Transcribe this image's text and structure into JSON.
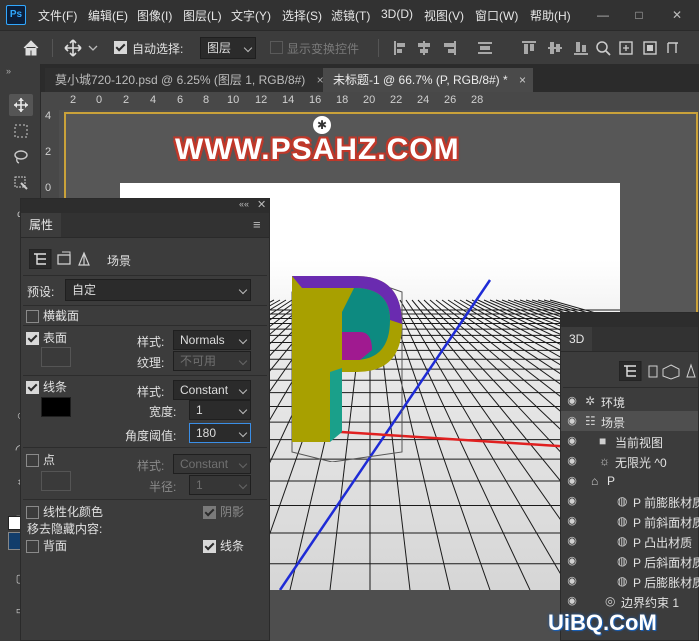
{
  "app": {
    "logo": "Ps"
  },
  "menu": [
    "文件(F)",
    "编辑(E)",
    "图像(I)",
    "图层(L)",
    "文字(Y)",
    "选择(S)",
    "滤镜(T)",
    "3D(D)",
    "视图(V)",
    "窗口(W)",
    "帮助(H)"
  ],
  "window_controls": {
    "minimize": "—",
    "maximize": "□",
    "close": "✕"
  },
  "options": {
    "auto_select_label": "自动选择:",
    "auto_select_value": "图层",
    "show_transform_label": "显示变换控件"
  },
  "tabs": [
    {
      "label": "莫小城720-120.psd @ 6.25% (图层 1, RGB/8#)",
      "close": "×"
    },
    {
      "label": "未标题-1 @ 66.7% (P, RGB/8#) *",
      "close": "×"
    }
  ],
  "rulers": {
    "top": [
      "2",
      "0",
      "2",
      "4",
      "6",
      "8",
      "10",
      "12",
      "14",
      "16",
      "18",
      "20",
      "22",
      "24",
      "26",
      "28"
    ],
    "left": [
      "4",
      "2",
      "0"
    ]
  },
  "canvas": {
    "watermark": "WWW.PSAHZ.COM",
    "model_letter": "P"
  },
  "properties": {
    "title": "属性",
    "tab_label": "场景",
    "preset_label": "预设:",
    "preset_value": "自定",
    "cross_section_label": "横截面",
    "surface_label": "表面",
    "surface_style_label": "样式:",
    "surface_style_value": "Normals",
    "texture_label": "纹理:",
    "texture_value": "不可用",
    "lines_label": "线条",
    "lines_style_label": "样式:",
    "lines_style_value": "Constant",
    "width_label": "宽度:",
    "width_value": "1",
    "angle_label": "角度阈值:",
    "angle_value": "180",
    "points_label": "点",
    "points_style_label": "样式:",
    "points_style_value": "Constant",
    "radius_label": "半径:",
    "radius_value": "1",
    "linearize_label": "线性化颜色",
    "shadow_label": "阴影",
    "remove_hidden_label": "移去隐藏内容:",
    "back_label": "背面",
    "lines2_label": "线条"
  },
  "panel3d": {
    "title": "3D",
    "items": [
      {
        "label": "环境",
        "icon": "environment-icon"
      },
      {
        "label": "场景",
        "icon": "scene-icon"
      },
      {
        "label": "当前视图",
        "icon": "camera-icon"
      },
      {
        "label": "无限光 ^0",
        "icon": "light-icon"
      },
      {
        "label": "P",
        "icon": "mesh-icon"
      },
      {
        "label": "P 前膨胀材质",
        "icon": "material-icon"
      },
      {
        "label": "P 前斜面材质",
        "icon": "material-icon"
      },
      {
        "label": "P 凸出材质",
        "icon": "material-icon"
      },
      {
        "label": "P 后斜面材质",
        "icon": "material-icon"
      },
      {
        "label": "P 后膨胀材质",
        "icon": "material-icon"
      },
      {
        "label": "边界约束 1",
        "icon": "constraint-icon"
      }
    ]
  },
  "colors": {
    "accent_blue": "#31a8ff",
    "artboard_border": "#caa23a",
    "axis_red": "#e02020",
    "axis_blue": "#1e2bd6"
  },
  "site_logo": "UiBQ.CoM"
}
